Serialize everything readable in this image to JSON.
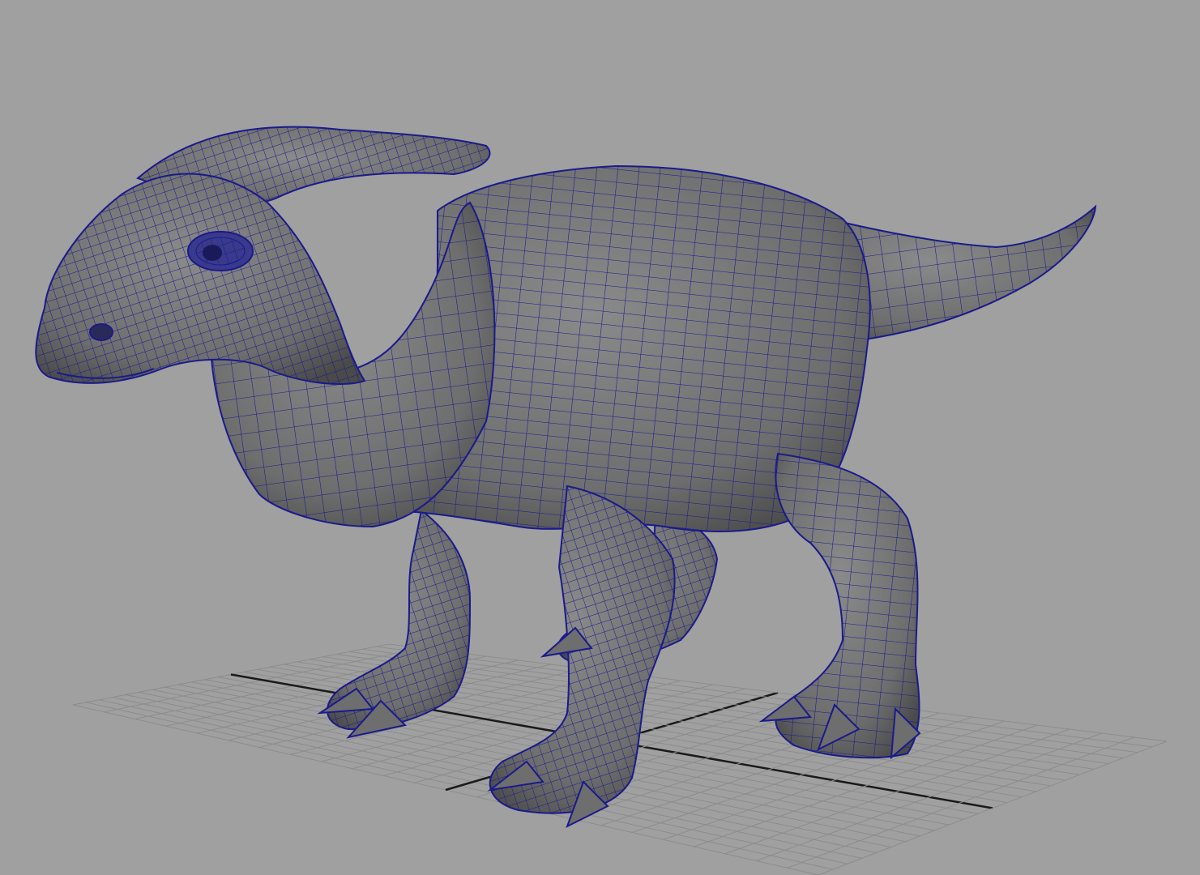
{
  "viewport": {
    "background_color": "#a0a0a0",
    "grid_line_color": "#8c8c8c",
    "grid_axis_color": "#1a1a1a",
    "wireframe_color": "#1a1a8c",
    "mesh_fill_color": "#6e6e6e",
    "mesh_shadow_color": "#4a4a4a",
    "mesh_highlight_color": "#8a8a8a"
  },
  "model": {
    "icon": "dinosaur-mesh",
    "parts": [
      "head",
      "crest",
      "eye",
      "neck",
      "body",
      "tail",
      "front-left-leg",
      "front-right-leg",
      "back-left-leg",
      "back-right-leg"
    ]
  }
}
